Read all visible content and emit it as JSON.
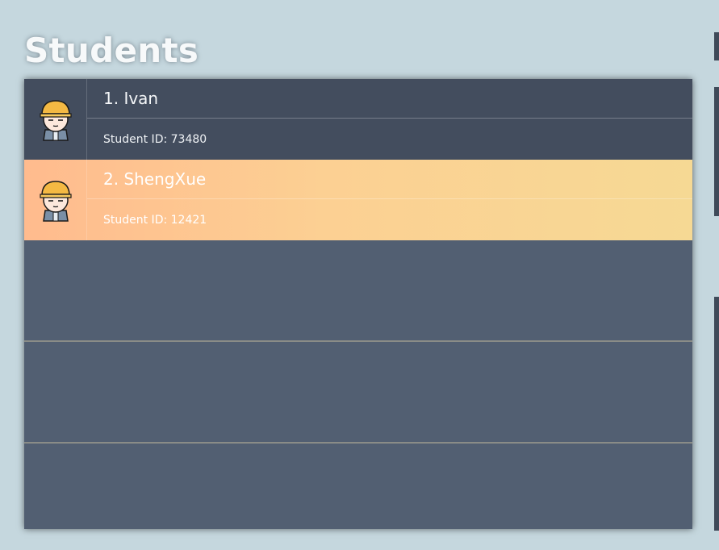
{
  "page": {
    "title": "Students"
  },
  "students": [
    {
      "name": "1. Ivan",
      "id_text": "Student ID: 73480",
      "avatar_icon": "student-avatar-icon",
      "selected": false
    },
    {
      "name": "2. ShengXue",
      "id_text": "Student ID: 12421",
      "avatar_icon": "student-avatar-icon",
      "selected": true
    }
  ],
  "colors": {
    "background": "#c5d7de",
    "list_background": "#525f72",
    "row_background": "#434d5e",
    "selected_gradient_start": "#ffbb8e",
    "selected_gradient_end": "#f6d994"
  }
}
